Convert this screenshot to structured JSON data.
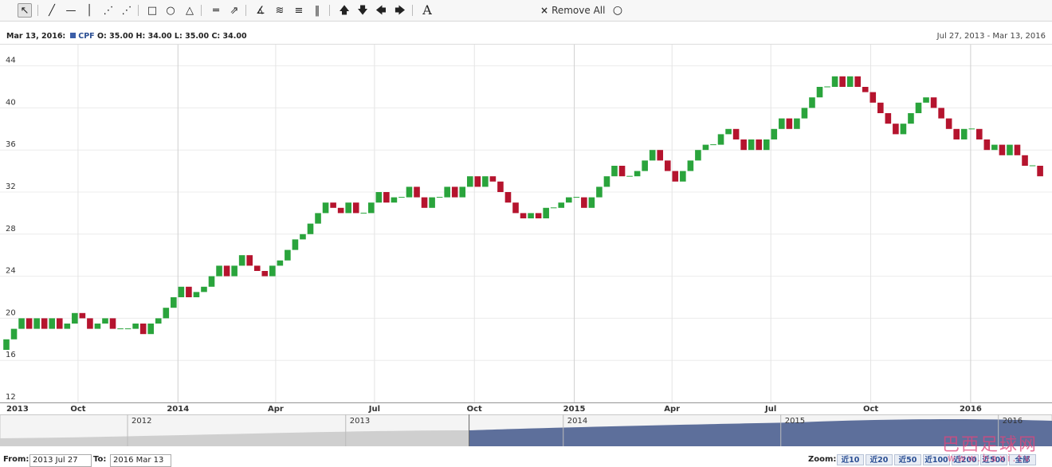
{
  "toolbar": {
    "tools": [
      {
        "name": "cursor-tool",
        "glyph": "↖"
      },
      {
        "name": "trendline-tool",
        "glyph": "╱"
      },
      {
        "name": "horizontal-line-tool",
        "glyph": "—"
      },
      {
        "name": "vertical-line-tool",
        "glyph": "│"
      },
      {
        "name": "dashed-line-tool",
        "glyph": "⋰"
      },
      {
        "name": "ray-tool",
        "glyph": "⋰"
      },
      {
        "name": "rectangle-tool",
        "glyph": "□"
      },
      {
        "name": "circle-tool",
        "glyph": "○"
      },
      {
        "name": "triangle-tool",
        "glyph": "△"
      },
      {
        "name": "parallel-channel-tool",
        "glyph": "═"
      },
      {
        "name": "pitchfork-tool",
        "glyph": "⇗"
      },
      {
        "name": "fan-tool",
        "glyph": "∡"
      },
      {
        "name": "arc-tool",
        "glyph": "≋"
      },
      {
        "name": "fibonacci-tool",
        "glyph": "≡"
      },
      {
        "name": "cycle-lines-tool",
        "glyph": "‖"
      },
      {
        "name": "arrow-up-tool",
        "glyph": "🡅"
      },
      {
        "name": "arrow-down-tool",
        "glyph": "🡇"
      },
      {
        "name": "arrow-left-tool",
        "glyph": "🡄"
      },
      {
        "name": "arrow-right-tool",
        "glyph": "🡆"
      },
      {
        "name": "text-tool",
        "glyph": "A"
      }
    ],
    "remove_all_label": "Remove All"
  },
  "info": {
    "date": "Mar 13, 2016:",
    "symbol": "CPF",
    "ohlc": "O: 35.00  H: 34.00  L: 35.00  C: 34.00"
  },
  "range_label": "Jul 27, 2013 - Mar 13, 2016",
  "chart_data": {
    "type": "candlestick",
    "symbol": "CPF",
    "ylim": [
      12,
      47
    ],
    "y_ticks": [
      12,
      16,
      20,
      24,
      28,
      32,
      36,
      40,
      44
    ],
    "xlim": [
      "2013-07-27",
      "2016-03-13"
    ],
    "x_ticks": [
      {
        "label": "2013",
        "date": "2013-07-27",
        "major": true
      },
      {
        "label": "Oct",
        "date": "2013-10-01",
        "major": false
      },
      {
        "label": "2014",
        "date": "2014-01-01",
        "major": true
      },
      {
        "label": "Apr",
        "date": "2014-04-01",
        "major": false
      },
      {
        "label": "Jul",
        "date": "2014-07-01",
        "major": false
      },
      {
        "label": "Oct",
        "date": "2014-10-01",
        "major": false
      },
      {
        "label": "2015",
        "date": "2015-01-01",
        "major": true
      },
      {
        "label": "Apr",
        "date": "2015-04-01",
        "major": false
      },
      {
        "label": "Jul",
        "date": "2015-07-01",
        "major": false
      },
      {
        "label": "Oct",
        "date": "2015-10-01",
        "major": false
      },
      {
        "label": "2016",
        "date": "2016-01-01",
        "major": true
      }
    ],
    "up_color": "#2aa43c",
    "down_color": "#b5142e",
    "candles": [
      {
        "d": "2013-07-27",
        "o": 17.0,
        "c": 18.0
      },
      {
        "d": "2013-08-03",
        "o": 18.0,
        "c": 19.0
      },
      {
        "d": "2013-08-10",
        "o": 19.0,
        "c": 20.0
      },
      {
        "d": "2013-08-17",
        "o": 20.0,
        "c": 19.0
      },
      {
        "d": "2013-08-24",
        "o": 19.0,
        "c": 20.0
      },
      {
        "d": "2013-08-31",
        "o": 20.0,
        "c": 19.0
      },
      {
        "d": "2013-09-07",
        "o": 19.0,
        "c": 20.0
      },
      {
        "d": "2013-09-14",
        "o": 20.0,
        "c": 19.0
      },
      {
        "d": "2013-09-21",
        "o": 19.0,
        "c": 19.5
      },
      {
        "d": "2013-09-28",
        "o": 19.5,
        "c": 20.5
      },
      {
        "d": "2013-10-05",
        "o": 20.5,
        "c": 20.0
      },
      {
        "d": "2013-10-12",
        "o": 20.0,
        "c": 19.0
      },
      {
        "d": "2013-10-19",
        "o": 19.0,
        "c": 19.5
      },
      {
        "d": "2013-10-26",
        "o": 19.5,
        "c": 20.0
      },
      {
        "d": "2013-11-02",
        "o": 20.0,
        "c": 19.0
      },
      {
        "d": "2013-11-09",
        "o": 19.0,
        "c": 19.0
      },
      {
        "d": "2013-11-16",
        "o": 19.0,
        "c": 19.0
      },
      {
        "d": "2013-11-23",
        "o": 19.0,
        "c": 19.5
      },
      {
        "d": "2013-11-30",
        "o": 19.5,
        "c": 18.5
      },
      {
        "d": "2013-12-07",
        "o": 18.5,
        "c": 19.5
      },
      {
        "d": "2013-12-14",
        "o": 19.5,
        "c": 20.0
      },
      {
        "d": "2013-12-21",
        "o": 20.0,
        "c": 21.0
      },
      {
        "d": "2013-12-28",
        "o": 21.0,
        "c": 22.0
      },
      {
        "d": "2014-01-04",
        "o": 22.0,
        "c": 23.0
      },
      {
        "d": "2014-01-11",
        "o": 23.0,
        "c": 22.0
      },
      {
        "d": "2014-01-18",
        "o": 22.0,
        "c": 22.5
      },
      {
        "d": "2014-01-25",
        "o": 22.5,
        "c": 23.0
      },
      {
        "d": "2014-02-01",
        "o": 23.0,
        "c": 24.0
      },
      {
        "d": "2014-02-08",
        "o": 24.0,
        "c": 25.0
      },
      {
        "d": "2014-02-15",
        "o": 25.0,
        "c": 24.0
      },
      {
        "d": "2014-02-22",
        "o": 24.0,
        "c": 25.0
      },
      {
        "d": "2014-03-01",
        "o": 25.0,
        "c": 26.0
      },
      {
        "d": "2014-03-08",
        "o": 26.0,
        "c": 25.0
      },
      {
        "d": "2014-03-15",
        "o": 25.0,
        "c": 24.5
      },
      {
        "d": "2014-03-22",
        "o": 24.5,
        "c": 24.0
      },
      {
        "d": "2014-03-29",
        "o": 24.0,
        "c": 25.0
      },
      {
        "d": "2014-04-05",
        "o": 25.0,
        "c": 25.5
      },
      {
        "d": "2014-04-12",
        "o": 25.5,
        "c": 26.5
      },
      {
        "d": "2014-04-19",
        "o": 26.5,
        "c": 27.5
      },
      {
        "d": "2014-04-26",
        "o": 27.5,
        "c": 28.0
      },
      {
        "d": "2014-05-03",
        "o": 28.0,
        "c": 29.0
      },
      {
        "d": "2014-05-10",
        "o": 29.0,
        "c": 30.0
      },
      {
        "d": "2014-05-17",
        "o": 30.0,
        "c": 31.0
      },
      {
        "d": "2014-05-24",
        "o": 31.0,
        "c": 30.5
      },
      {
        "d": "2014-05-31",
        "o": 30.5,
        "c": 30.0
      },
      {
        "d": "2014-06-07",
        "o": 30.0,
        "c": 31.0
      },
      {
        "d": "2014-06-14",
        "o": 31.0,
        "c": 30.0
      },
      {
        "d": "2014-06-21",
        "o": 30.0,
        "c": 30.0
      },
      {
        "d": "2014-06-28",
        "o": 30.0,
        "c": 31.0
      },
      {
        "d": "2014-07-05",
        "o": 31.0,
        "c": 32.0
      },
      {
        "d": "2014-07-12",
        "o": 32.0,
        "c": 31.0
      },
      {
        "d": "2014-07-19",
        "o": 31.0,
        "c": 31.5
      },
      {
        "d": "2014-07-26",
        "o": 31.5,
        "c": 31.5
      },
      {
        "d": "2014-08-02",
        "o": 31.5,
        "c": 32.5
      },
      {
        "d": "2014-08-09",
        "o": 32.5,
        "c": 31.5
      },
      {
        "d": "2014-08-16",
        "o": 31.5,
        "c": 30.5
      },
      {
        "d": "2014-08-23",
        "o": 30.5,
        "c": 31.5
      },
      {
        "d": "2014-08-30",
        "o": 31.5,
        "c": 31.5
      },
      {
        "d": "2014-09-06",
        "o": 31.5,
        "c": 32.5
      },
      {
        "d": "2014-09-13",
        "o": 32.5,
        "c": 31.5
      },
      {
        "d": "2014-09-20",
        "o": 31.5,
        "c": 32.5
      },
      {
        "d": "2014-09-27",
        "o": 32.5,
        "c": 33.5
      },
      {
        "d": "2014-10-04",
        "o": 33.5,
        "c": 32.5
      },
      {
        "d": "2014-10-11",
        "o": 32.5,
        "c": 33.5
      },
      {
        "d": "2014-10-18",
        "o": 33.5,
        "c": 33.0
      },
      {
        "d": "2014-10-25",
        "o": 33.0,
        "c": 32.0
      },
      {
        "d": "2014-11-01",
        "o": 32.0,
        "c": 31.0
      },
      {
        "d": "2014-11-08",
        "o": 31.0,
        "c": 30.0
      },
      {
        "d": "2014-11-15",
        "o": 30.0,
        "c": 29.5
      },
      {
        "d": "2014-11-22",
        "o": 29.5,
        "c": 30.0
      },
      {
        "d": "2014-11-29",
        "o": 30.0,
        "c": 29.5
      },
      {
        "d": "2014-12-06",
        "o": 29.5,
        "c": 30.5
      },
      {
        "d": "2014-12-13",
        "o": 30.5,
        "c": 30.5
      },
      {
        "d": "2014-12-20",
        "o": 30.5,
        "c": 31.0
      },
      {
        "d": "2014-12-27",
        "o": 31.0,
        "c": 31.5
      },
      {
        "d": "2015-01-03",
        "o": 31.5,
        "c": 31.5
      },
      {
        "d": "2015-01-10",
        "o": 31.5,
        "c": 30.5
      },
      {
        "d": "2015-01-17",
        "o": 30.5,
        "c": 31.5
      },
      {
        "d": "2015-01-24",
        "o": 31.5,
        "c": 32.5
      },
      {
        "d": "2015-01-31",
        "o": 32.5,
        "c": 33.5
      },
      {
        "d": "2015-02-07",
        "o": 33.5,
        "c": 34.5
      },
      {
        "d": "2015-02-14",
        "o": 34.5,
        "c": 33.5
      },
      {
        "d": "2015-02-21",
        "o": 33.5,
        "c": 33.5
      },
      {
        "d": "2015-02-28",
        "o": 33.5,
        "c": 34.0
      },
      {
        "d": "2015-03-07",
        "o": 34.0,
        "c": 35.0
      },
      {
        "d": "2015-03-14",
        "o": 35.0,
        "c": 36.0
      },
      {
        "d": "2015-03-21",
        "o": 36.0,
        "c": 35.0
      },
      {
        "d": "2015-03-28",
        "o": 35.0,
        "c": 34.0
      },
      {
        "d": "2015-04-04",
        "o": 34.0,
        "c": 33.0
      },
      {
        "d": "2015-04-11",
        "o": 33.0,
        "c": 34.0
      },
      {
        "d": "2015-04-18",
        "o": 34.0,
        "c": 35.0
      },
      {
        "d": "2015-04-25",
        "o": 35.0,
        "c": 36.0
      },
      {
        "d": "2015-05-02",
        "o": 36.0,
        "c": 36.5
      },
      {
        "d": "2015-05-09",
        "o": 36.5,
        "c": 36.5
      },
      {
        "d": "2015-05-16",
        "o": 36.5,
        "c": 37.5
      },
      {
        "d": "2015-05-23",
        "o": 37.5,
        "c": 38.0
      },
      {
        "d": "2015-05-30",
        "o": 38.0,
        "c": 37.0
      },
      {
        "d": "2015-06-06",
        "o": 37.0,
        "c": 36.0
      },
      {
        "d": "2015-06-13",
        "o": 36.0,
        "c": 37.0
      },
      {
        "d": "2015-06-20",
        "o": 37.0,
        "c": 36.0
      },
      {
        "d": "2015-06-27",
        "o": 36.0,
        "c": 37.0
      },
      {
        "d": "2015-07-04",
        "o": 37.0,
        "c": 38.0
      },
      {
        "d": "2015-07-11",
        "o": 38.0,
        "c": 39.0
      },
      {
        "d": "2015-07-18",
        "o": 39.0,
        "c": 38.0
      },
      {
        "d": "2015-07-25",
        "o": 38.0,
        "c": 39.0
      },
      {
        "d": "2015-08-01",
        "o": 39.0,
        "c": 40.0
      },
      {
        "d": "2015-08-08",
        "o": 40.0,
        "c": 41.0
      },
      {
        "d": "2015-08-15",
        "o": 41.0,
        "c": 42.0
      },
      {
        "d": "2015-08-22",
        "o": 42.0,
        "c": 42.0
      },
      {
        "d": "2015-08-29",
        "o": 42.0,
        "c": 43.0
      },
      {
        "d": "2015-09-05",
        "o": 43.0,
        "c": 42.0
      },
      {
        "d": "2015-09-12",
        "o": 42.0,
        "c": 43.0
      },
      {
        "d": "2015-09-19",
        "o": 43.0,
        "c": 42.0
      },
      {
        "d": "2015-09-26",
        "o": 42.0,
        "c": 41.5
      },
      {
        "d": "2015-10-03",
        "o": 41.5,
        "c": 40.5
      },
      {
        "d": "2015-10-10",
        "o": 40.5,
        "c": 39.5
      },
      {
        "d": "2015-10-17",
        "o": 39.5,
        "c": 38.5
      },
      {
        "d": "2015-10-24",
        "o": 38.5,
        "c": 37.5
      },
      {
        "d": "2015-10-31",
        "o": 37.5,
        "c": 38.5
      },
      {
        "d": "2015-11-07",
        "o": 38.5,
        "c": 39.5
      },
      {
        "d": "2015-11-14",
        "o": 39.5,
        "c": 40.5
      },
      {
        "d": "2015-11-21",
        "o": 40.5,
        "c": 41.0
      },
      {
        "d": "2015-11-28",
        "o": 41.0,
        "c": 40.0
      },
      {
        "d": "2015-12-05",
        "o": 40.0,
        "c": 39.0
      },
      {
        "d": "2015-12-12",
        "o": 39.0,
        "c": 38.0
      },
      {
        "d": "2015-12-19",
        "o": 38.0,
        "c": 37.0
      },
      {
        "d": "2015-12-26",
        "o": 37.0,
        "c": 38.0
      },
      {
        "d": "2016-01-02",
        "o": 38.0,
        "c": 38.0
      },
      {
        "d": "2016-01-09",
        "o": 38.0,
        "c": 37.0
      },
      {
        "d": "2016-01-16",
        "o": 37.0,
        "c": 36.0
      },
      {
        "d": "2016-01-23",
        "o": 36.0,
        "c": 36.5
      },
      {
        "d": "2016-01-30",
        "o": 36.5,
        "c": 35.5
      },
      {
        "d": "2016-02-06",
        "o": 35.5,
        "c": 36.5
      },
      {
        "d": "2016-02-13",
        "o": 36.5,
        "c": 35.5
      },
      {
        "d": "2016-02-20",
        "o": 35.5,
        "c": 34.5
      },
      {
        "d": "2016-02-27",
        "o": 34.5,
        "c": 34.5
      },
      {
        "d": "2016-03-05",
        "o": 34.5,
        "c": 33.5
      }
    ]
  },
  "navigator": {
    "year_labels": [
      {
        "label": "2012",
        "date": "2012-01-01"
      },
      {
        "label": "2013",
        "date": "2013-01-01"
      },
      {
        "label": "2014",
        "date": "2014-01-01"
      },
      {
        "label": "2015",
        "date": "2015-01-01"
      },
      {
        "label": "2016",
        "date": "2016-01-01"
      }
    ],
    "range": [
      "2011-06-01",
      "2016-03-31"
    ],
    "selected_range": [
      "2013-07-27",
      "2016-03-13"
    ],
    "selected_color": "#5d6f9b",
    "unselected_color": "#cfcfcf"
  },
  "bottom": {
    "from_label": "From:",
    "from_value": "2013 Jul 27",
    "to_label": "To:",
    "to_value": "2016 Mar 13",
    "zoom_label": "Zoom:",
    "zoom_buttons": [
      "近10",
      "近20",
      "近50",
      "近100",
      "近200",
      "近500",
      "全部"
    ]
  },
  "watermark": {
    "text": "巴西足球网",
    "url": "www.baxi.tv"
  }
}
